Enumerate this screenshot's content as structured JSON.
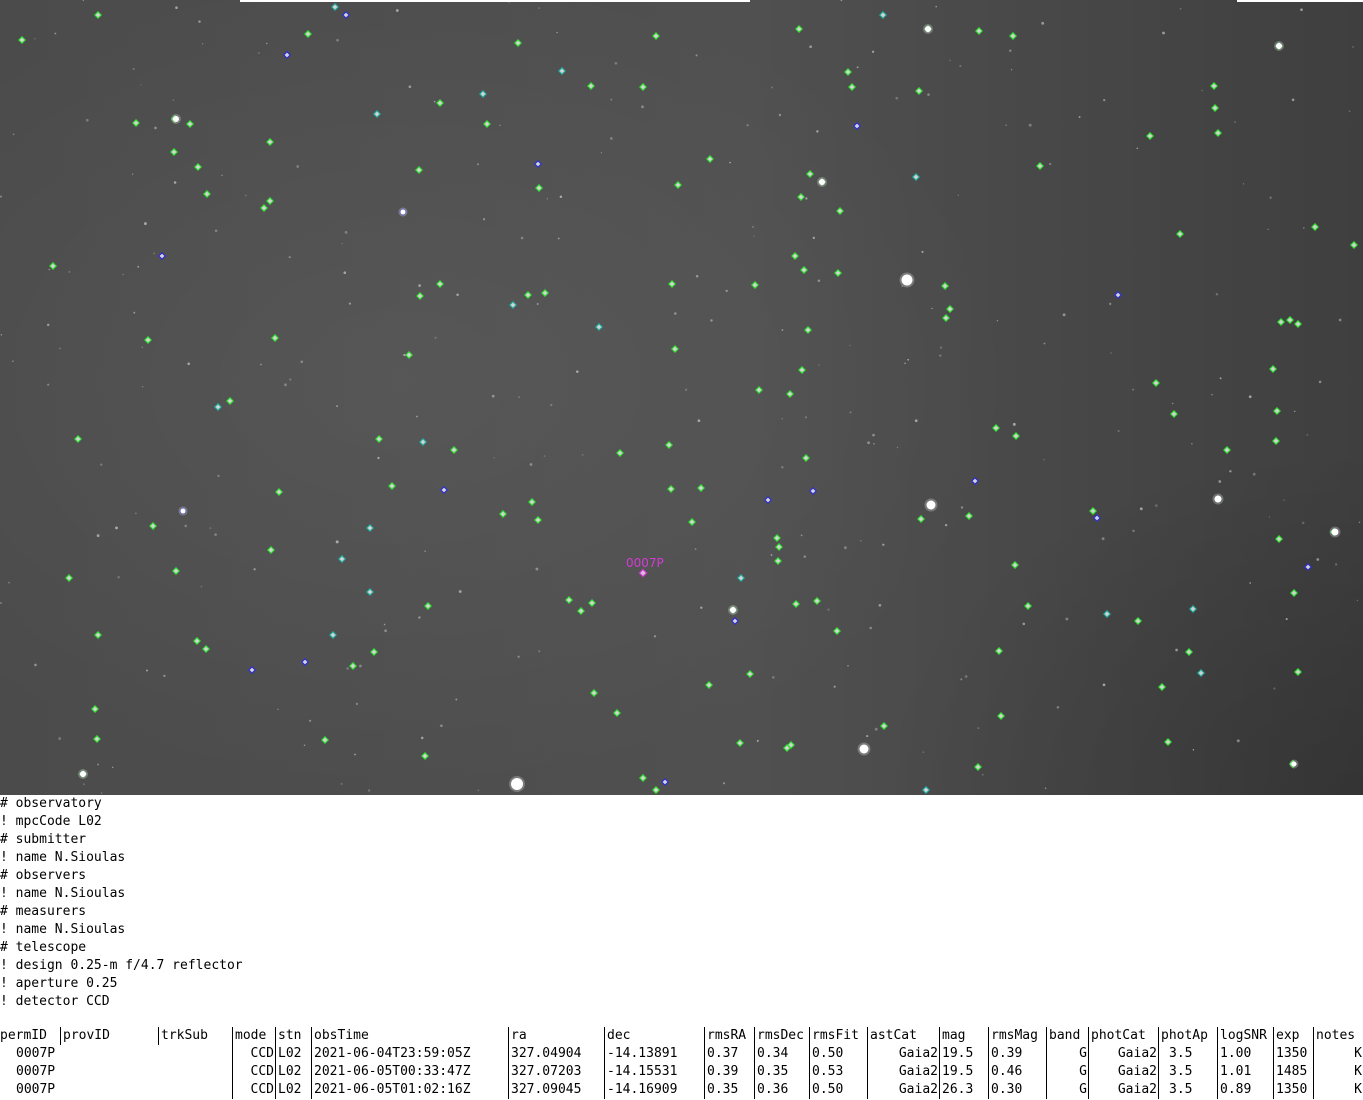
{
  "image": {
    "target_label": "0007P",
    "colors": {
      "sky": "#4d4d4d",
      "catalog_marker": "#2ee02e",
      "catalog_marker_alt": "#2a2ad6",
      "catalog_marker_teal": "#1fb0a0",
      "target_marker": "#d43bd4",
      "bright_star": "#ffffff"
    }
  },
  "header": {
    "lines": [
      "# observatory",
      "! mpcCode L02",
      "# submitter",
      "! name N.Sioulas",
      "# observers",
      "! name N.Sioulas",
      "# measurers",
      "! name N.Sioulas",
      "# telescope",
      "! design 0.25-m f/4.7 reflector",
      "! aperture 0.25",
      "! detector CCD"
    ]
  },
  "table": {
    "columns": [
      "permID",
      "provID",
      "trkSub",
      "mode",
      "stn",
      "obsTime",
      "ra",
      "dec",
      "rmsRA",
      "rmsDec",
      "rmsFit",
      "astCat",
      "mag",
      "rmsMag",
      "band",
      "photCat",
      "photAp",
      "logSNR",
      "exp",
      "notes"
    ],
    "rows": [
      [
        "0007P",
        "",
        "",
        "CCD",
        "L02",
        "2021-06-04T23:59:05Z",
        "327.04904",
        "-14.13891",
        "0.37",
        "0.34",
        "0.50",
        "Gaia2",
        "19.5",
        "0.39",
        "G",
        "Gaia2",
        "3.5",
        "1.00",
        "1350",
        "K"
      ],
      [
        "0007P",
        "",
        "",
        "CCD",
        "L02",
        "2021-06-05T00:33:47Z",
        "327.07203",
        "-14.15531",
        "0.39",
        "0.35",
        "0.53",
        "Gaia2",
        "19.5",
        "0.46",
        "G",
        "Gaia2",
        "3.5",
        "1.01",
        "1485",
        "K"
      ],
      [
        "0007P",
        "",
        "",
        "CCD",
        "L02",
        "2021-06-05T01:02:16Z",
        "327.09045",
        "-14.16909",
        "0.35",
        "0.36",
        "0.50",
        "Gaia2",
        "26.3",
        "0.30",
        "G",
        "Gaia2",
        "3.5",
        "0.89",
        "1350",
        "K"
      ]
    ]
  }
}
